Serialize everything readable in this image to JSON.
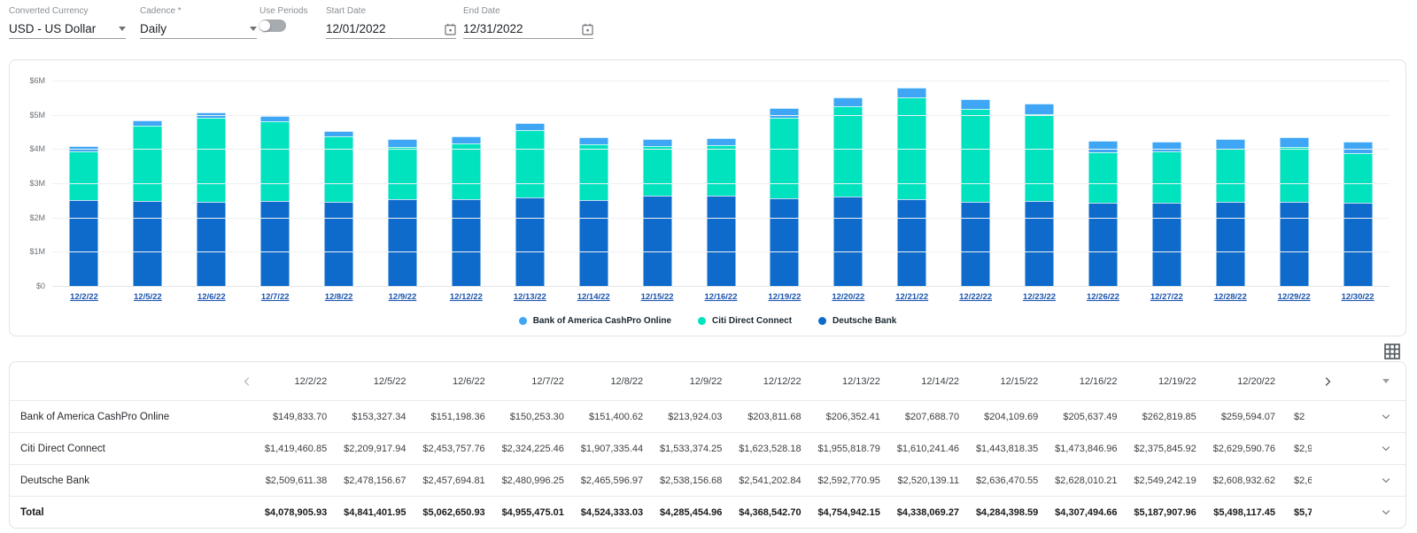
{
  "controls": {
    "converted_currency": {
      "label": "Converted Currency",
      "value": "USD - US Dollar"
    },
    "cadence": {
      "label": "Cadence *",
      "value": "Daily"
    },
    "use_periods": {
      "label": "Use Periods",
      "state": "off"
    },
    "start_date": {
      "label": "Start Date",
      "value": "12/01/2022"
    },
    "end_date": {
      "label": "End Date",
      "value": "12/31/2022"
    }
  },
  "icons": {
    "select-arrow-icon": "triangle-down",
    "calendar-icon": "outlined-calendar",
    "toggle-switch": "material-switch-off",
    "grid-view-icon": "3x3-grid",
    "chevron-left-icon": "thin-angle-left",
    "chevron-right-icon": "thin-angle-right",
    "chevron-down-icon": "thin-angle-down",
    "caret-down-icon": "filled-triangle-down"
  },
  "colors": {
    "bofa_blue": "#3EA6F5",
    "citi_mint": "#00E3BE",
    "deutsche_blue": "#0E6BCB",
    "date_link_blue": "#1A53AE"
  },
  "chart_data": {
    "type": "bar",
    "stacked": true,
    "x": [
      "12/2/22",
      "12/5/22",
      "12/6/22",
      "12/7/22",
      "12/8/22",
      "12/9/22",
      "12/12/22",
      "12/13/22",
      "12/14/22",
      "12/15/22",
      "12/16/22",
      "12/19/22",
      "12/20/22",
      "12/21/22",
      "12/22/22",
      "12/23/22",
      "12/26/22",
      "12/27/22",
      "12/28/22",
      "12/29/22",
      "12/30/22"
    ],
    "series": [
      {
        "name": "Deutsche Bank",
        "color": "#0E6BCB",
        "values": [
          2509611,
          2478157,
          2457695,
          2480996,
          2465597,
          2538157,
          2541203,
          2592771,
          2520139,
          2636471,
          2628010,
          2549242,
          2608933,
          2540000,
          2470000,
          2490000,
          2430000,
          2420000,
          2450000,
          2470000,
          2440000
        ]
      },
      {
        "name": "Citi Direct Connect",
        "color": "#00E3BE",
        "values": [
          1419461,
          2209918,
          2453758,
          2324225,
          1907335,
          1533374,
          1623528,
          1955819,
          1610241,
          1443818,
          1473847,
          2375846,
          2629591,
          2980000,
          2710000,
          2530000,
          1470000,
          1500000,
          1550000,
          1580000,
          1440000
        ]
      },
      {
        "name": "Bank of America CashPro Online",
        "color": "#3EA6F5",
        "values": [
          149834,
          153327,
          151198,
          150253,
          151401,
          213924,
          203812,
          206352,
          207689,
          204110,
          205637,
          262820,
          259594,
          270000,
          290000,
          300000,
          330000,
          300000,
          300000,
          290000,
          330000
        ]
      }
    ],
    "y_ticks": [
      "$6M",
      "$5M",
      "$4M",
      "$3M",
      "$2M",
      "$1M",
      "$0"
    ],
    "ylim": [
      0,
      6000000
    ],
    "grid": true,
    "legend_position": "bottom",
    "legend": [
      {
        "name": "Bank of America CashPro Online",
        "color": "#3EA6F5"
      },
      {
        "name": "Citi Direct Connect",
        "color": "#00E3BE"
      },
      {
        "name": "Deutsche Bank",
        "color": "#0E6BCB"
      }
    ]
  },
  "table": {
    "columns": [
      "12/2/22",
      "12/5/22",
      "12/6/22",
      "12/7/22",
      "12/8/22",
      "12/9/22",
      "12/12/22",
      "12/13/22",
      "12/14/22",
      "12/15/22",
      "12/16/22",
      "12/19/22",
      "12/20/22"
    ],
    "rows": [
      {
        "label": "Bank of America CashPro Online",
        "bold": false,
        "clipped_next_value": "$2",
        "values": [
          "$149,833.70",
          "$153,327.34",
          "$151,198.36",
          "$150,253.30",
          "$151,400.62",
          "$213,924.03",
          "$203,811.68",
          "$206,352.41",
          "$207,688.70",
          "$204,109.69",
          "$205,637.49",
          "$262,819.85",
          "$259,594.07"
        ]
      },
      {
        "label": "Citi Direct Connect",
        "bold": false,
        "clipped_next_value": "$2,9",
        "values": [
          "$1,419,460.85",
          "$2,209,917.94",
          "$2,453,757.76",
          "$2,324,225.46",
          "$1,907,335.44",
          "$1,533,374.25",
          "$1,623,528.18",
          "$1,955,818.79",
          "$1,610,241.46",
          "$1,443,818.35",
          "$1,473,846.96",
          "$2,375,845.92",
          "$2,629,590.76"
        ]
      },
      {
        "label": "Deutsche Bank",
        "bold": false,
        "clipped_next_value": "$2,6",
        "values": [
          "$2,509,611.38",
          "$2,478,156.67",
          "$2,457,694.81",
          "$2,480,996.25",
          "$2,465,596.97",
          "$2,538,156.68",
          "$2,541,202.84",
          "$2,592,770.95",
          "$2,520,139.11",
          "$2,636,470.55",
          "$2,628,010.21",
          "$2,549,242.19",
          "$2,608,932.62"
        ]
      },
      {
        "label": "Total",
        "bold": true,
        "clipped_next_value": "$5,7",
        "values": [
          "$4,078,905.93",
          "$4,841,401.95",
          "$5,062,650.93",
          "$4,955,475.01",
          "$4,524,333.03",
          "$4,285,454.96",
          "$4,368,542.70",
          "$4,754,942.15",
          "$4,338,069.27",
          "$4,284,398.59",
          "$4,307,494.66",
          "$5,187,907.96",
          "$5,498,117.45"
        ]
      }
    ]
  }
}
